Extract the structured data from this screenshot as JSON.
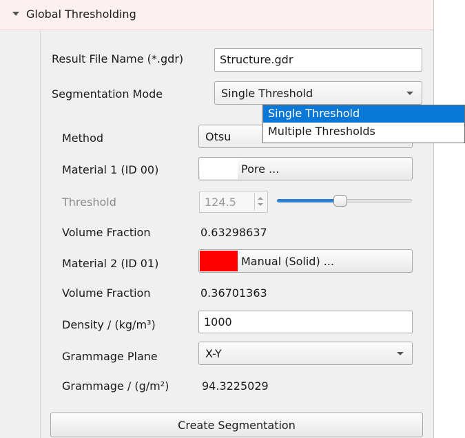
{
  "section": {
    "title": "Global Thresholding"
  },
  "result_file": {
    "label": "Result File Name (*.gdr)",
    "value": "Structure.gdr"
  },
  "segmentation_mode": {
    "label": "Segmentation Mode",
    "selected": "Single Threshold",
    "options": [
      "Single Threshold",
      "Multiple Thresholds"
    ],
    "highlighted_index": 0
  },
  "method": {
    "label": "Method",
    "selected": "Otsu"
  },
  "material1": {
    "label": "Material 1 (ID 00)",
    "button": "Pore ...",
    "color": "#ffffff"
  },
  "threshold": {
    "label": "Threshold",
    "value": "124.5",
    "slider_fraction": 0.49,
    "enabled": false
  },
  "volume_fraction1": {
    "label": "Volume Fraction",
    "value": "0.63298637"
  },
  "material2": {
    "label": "Material 2 (ID 01)",
    "button": "Manual (Solid) ...",
    "color": "#ff0000"
  },
  "volume_fraction2": {
    "label": "Volume Fraction",
    "value": "0.36701363"
  },
  "density": {
    "label": "Density / (kg/m³)",
    "value": "1000"
  },
  "grammage_plane": {
    "label": "Grammage Plane",
    "selected": "X-Y"
  },
  "grammage": {
    "label": "Grammage / (g/m²)",
    "value": "94.3225029"
  },
  "create_button": {
    "label": "Create Segmentation"
  },
  "colors": {
    "accent": "#0a78d7",
    "slider": "#2d7fd3",
    "header_bg": "#fcf0f0",
    "panel_bg": "#f0f0f0"
  }
}
